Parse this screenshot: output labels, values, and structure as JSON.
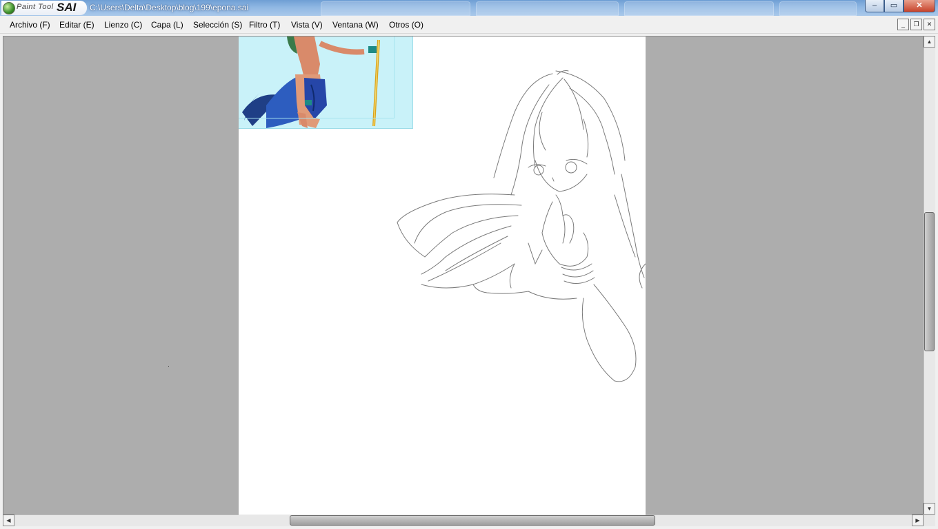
{
  "app": {
    "logo_primary": "Paint Tool",
    "logo_secondary": "SAI",
    "file_path": "C:\\Users\\Delta\\Desktop\\blog\\199\\epona.sai"
  },
  "window_controls": {
    "minimize": "–",
    "maximize": "▭",
    "close": "✕"
  },
  "menu": {
    "items": [
      "Archivo (F)",
      "Editar (E)",
      "Lienzo (C)",
      "Capa (L)",
      "Selección (S)",
      "Filtro (T)",
      "Vista (V)",
      "Ventana (W)",
      "Otros (O)"
    ]
  },
  "mdi_controls": {
    "minimize": "_",
    "restore": "❐",
    "close": "✕"
  },
  "scroll": {
    "up": "▲",
    "down": "▼",
    "left": "◀",
    "right": "▶"
  },
  "colors": {
    "workspace": "#adadad",
    "paper": "#ffffff",
    "titlebar": "#8fb7e3"
  },
  "canvas": {
    "reference_image": "warrior-character-reference",
    "sketch": "girl-line-sketch"
  }
}
